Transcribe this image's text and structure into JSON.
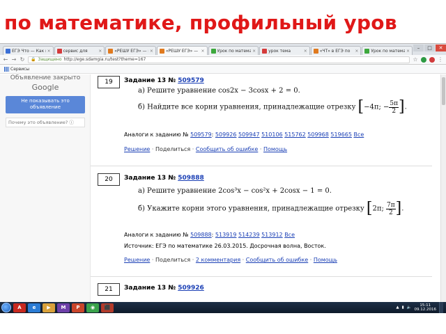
{
  "slide": {
    "title": "по математике, профильный уров"
  },
  "browser": {
    "tabs": [
      {
        "label": "ЕГЭ Что — Как по ма",
        "color": "#3b6fd6",
        "active": false
      },
      {
        "label": "сервис для",
        "color": "#d43b3b",
        "active": false
      },
      {
        "label": "«РЕШУ ЕГЭ» — ма",
        "color": "#e07a1f",
        "active": false
      },
      {
        "label": "«РЕШУ ЕГЭ» — м",
        "color": "#e07a1f",
        "active": true
      },
      {
        "label": "Урок по математике",
        "color": "#3da83d",
        "active": false
      },
      {
        "label": "урок тема",
        "color": "#d43b3b",
        "active": false
      },
      {
        "label": "«ЧТ» в ЕГЭ по",
        "color": "#e07a1f",
        "active": false
      },
      {
        "label": "Урок по математике",
        "color": "#3da83d",
        "active": false
      }
    ],
    "url": "http://ege.sdamgia.ru/test?theme=167",
    "secure_label": "Защищено",
    "bookmarks_label": "Сервисы",
    "window_buttons": {
      "minimize": "–",
      "maximize": "□",
      "close": "✕"
    }
  },
  "ad": {
    "closed_text": "Объявление закрыто",
    "brand": "Google",
    "hide_button": "Не показывать это объявление",
    "why_text": "Почему это объявление? ⓘ"
  },
  "problems": [
    {
      "number": "19",
      "header_prefix": "Задание 13 №",
      "id": "509579",
      "part_a": "а) Решите уравнение cos2x − 3cosx + 2 = 0.",
      "part_b": "б) Найдите все корни уравнения, принадлежащие отрезку",
      "segment_left": "−4π; −",
      "segment_num": "5π",
      "segment_den": "2",
      "analogs_label": "Аналоги к заданию №",
      "analogs": [
        "509579",
        "509926",
        "509947",
        "510106",
        "515762",
        "509968",
        "519665",
        "Все"
      ],
      "links": [
        "Решение",
        "Поделиться",
        "Сообщить об ошибке",
        "Помощь"
      ]
    },
    {
      "number": "20",
      "header_prefix": "Задание 13 №",
      "id": "509888",
      "part_a": "а) Решите уравнение 2cos³x − cos²x + 2cosx − 1 = 0.",
      "part_b": "б) Укажите корни этого уравнения, принадлежащие отрезку",
      "segment_left": "2π; ",
      "segment_num": "7π",
      "segment_den": "2",
      "analogs_label": "Аналоги к заданию №",
      "analogs": [
        "509888",
        "513919",
        "514239",
        "513912",
        "Все"
      ],
      "source": "Источник: ЕГЭ по математике 26.03.2015. Досрочная волна, Восток.",
      "links": [
        "Решение",
        "Поделиться",
        "2 комментария",
        "Сообщить об ошибке",
        "Помощь"
      ]
    },
    {
      "number": "21",
      "header_prefix": "Задание 13 №",
      "id": "509926"
    }
  ],
  "taskbar": {
    "apps": [
      {
        "name": "acrobat",
        "color": "#c8291f",
        "glyph": "A"
      },
      {
        "name": "ie",
        "color": "#2a7bd4",
        "glyph": "e"
      },
      {
        "name": "media",
        "color": "#d9a13a",
        "glyph": "▶"
      },
      {
        "name": "vs",
        "color": "#6d3fa8",
        "glyph": "M"
      },
      {
        "name": "powerpoint",
        "color": "#c9452a",
        "glyph": "P"
      },
      {
        "name": "chrome",
        "color": "#3aa24b",
        "glyph": "◉"
      },
      {
        "name": "pdf",
        "color": "#b33a2a",
        "glyph": "⬛"
      }
    ],
    "time": "15:11",
    "date": "09.12.2016"
  },
  "colors": {
    "title_red": "#e01818",
    "link_blue": "#1a3fb5",
    "ad_button": "#5a87d8"
  }
}
